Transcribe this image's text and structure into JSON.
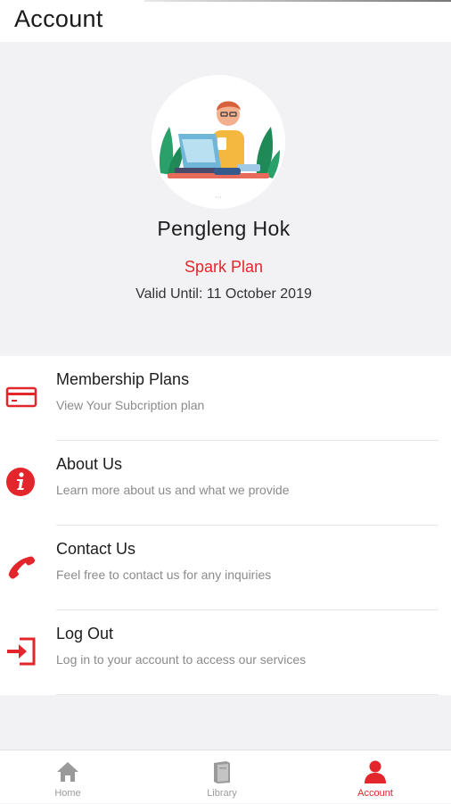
{
  "header": {
    "title": "Account"
  },
  "profile": {
    "name": "Pengleng Hok",
    "plan": "Spark Plan",
    "valid_until": "Valid Until: 11 October 2019"
  },
  "menu": {
    "items": [
      {
        "label": "Membership Plans",
        "description": "View Your Subcription plan",
        "icon": "credit-card-icon"
      },
      {
        "label": "About Us",
        "description": "Learn more about us and what we provide",
        "icon": "info-icon"
      },
      {
        "label": "Contact Us",
        "description": "Feel free to contact us for any inquiries",
        "icon": "phone-icon"
      },
      {
        "label": "Log Out",
        "description": "Log in to your account to access our services",
        "icon": "logout-icon"
      }
    ]
  },
  "nav": {
    "items": [
      {
        "label": "Home",
        "icon": "home-icon",
        "active": false
      },
      {
        "label": "Library",
        "icon": "book-icon",
        "active": false
      },
      {
        "label": "Account",
        "icon": "user-icon",
        "active": true
      }
    ]
  },
  "colors": {
    "accent": "#e3262b",
    "background": "#f2f2f4",
    "inactive": "#9a9a9a"
  }
}
